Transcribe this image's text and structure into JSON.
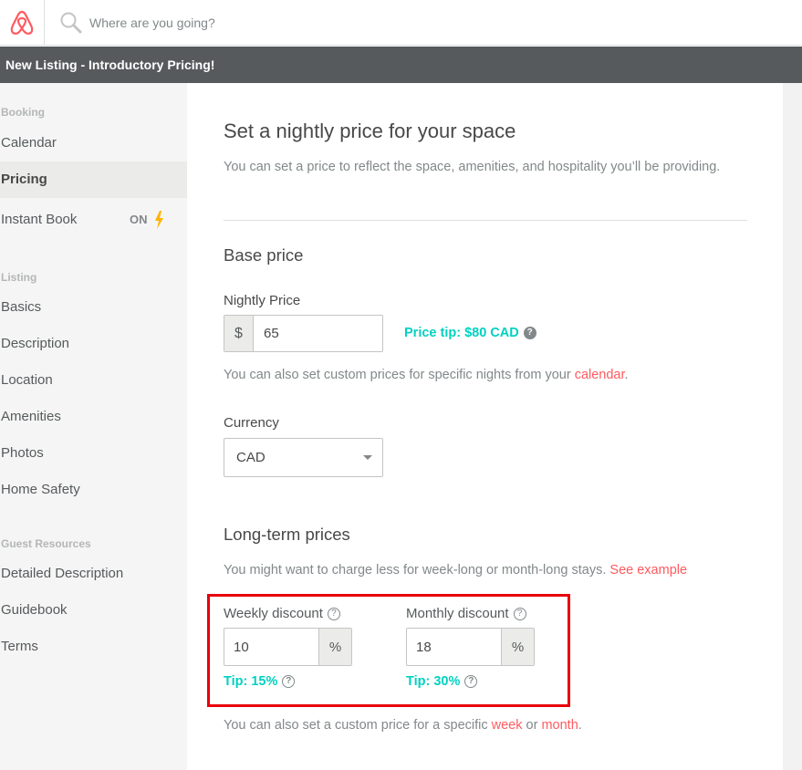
{
  "header": {
    "logo": "airbnb-logo",
    "search": {
      "placeholder": "Where are you going?",
      "value": ""
    }
  },
  "banner": {
    "text": "New Listing - Introductory Pricing!"
  },
  "sidebar": {
    "sections": [
      {
        "heading": "Booking",
        "items": [
          {
            "label": "Calendar",
            "active": false
          },
          {
            "label": "Pricing",
            "active": true
          },
          {
            "label": "Instant Book",
            "badge": "ON",
            "badge_icon": "lightning-bolt-icon",
            "active": false
          }
        ]
      },
      {
        "heading": "Listing",
        "items": [
          {
            "label": "Basics"
          },
          {
            "label": "Description"
          },
          {
            "label": "Location"
          },
          {
            "label": "Amenities"
          },
          {
            "label": "Photos"
          },
          {
            "label": "Home Safety"
          }
        ]
      },
      {
        "heading": "Guest Resources",
        "items": [
          {
            "label": "Detailed Description"
          },
          {
            "label": "Guidebook"
          },
          {
            "label": "Terms"
          }
        ]
      }
    ]
  },
  "main": {
    "title": "Set a nightly price for your space",
    "subtitle": "You can set a price to reflect the space, amenities, and hospitality you’ll be providing.",
    "base_price": {
      "heading": "Base price",
      "nightly_label": "Nightly Price",
      "currency_symbol": "$",
      "nightly_value": "65",
      "price_tip": "Price tip: $80 CAD",
      "help_icon": "?",
      "custom_prefix": "You can also set custom prices for specific nights from your ",
      "custom_link": "calendar",
      "custom_suffix": "."
    },
    "currency": {
      "label": "Currency",
      "selected": "CAD"
    },
    "long_term": {
      "heading": "Long-term prices",
      "description": "You might want to charge less for week-long or month-long stays. ",
      "see_example": "See example",
      "weekly": {
        "label": "Weekly discount",
        "value": "10",
        "unit": "%",
        "tip": "Tip: 15%"
      },
      "monthly": {
        "label": "Monthly discount",
        "value": "18",
        "unit": "%",
        "tip": "Tip: 30%"
      },
      "custom_prefix": "You can also set a custom price for a specific ",
      "week_link": "week",
      "or_text": " or ",
      "month_link": "month",
      "custom_suffix": "."
    }
  },
  "colors": {
    "brand": "#ff5a5f",
    "tip": "#00d1c1",
    "banner_bg": "#565a5c",
    "highlight": "#e8000b",
    "bolt": "#ffb400"
  }
}
